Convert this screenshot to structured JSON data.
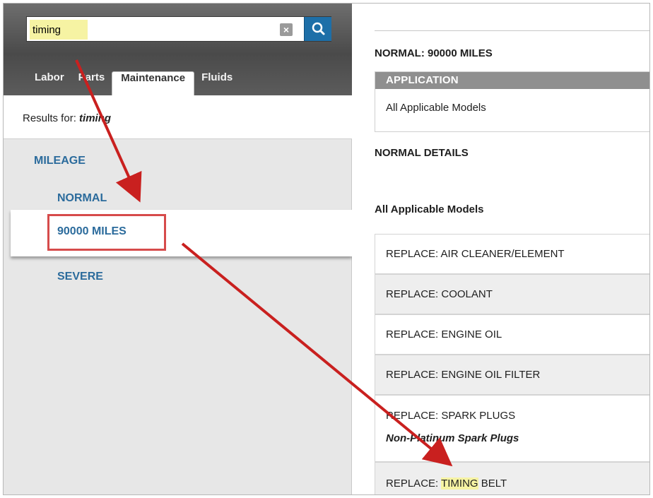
{
  "search": {
    "value": "timing"
  },
  "tabs": [
    {
      "label": "Labor"
    },
    {
      "label": "Parts"
    },
    {
      "label": "Maintenance"
    },
    {
      "label": "Fluids"
    }
  ],
  "results": {
    "prefix": "Results for: ",
    "term": "timing"
  },
  "tree": {
    "mileage": "MILEAGE",
    "normal": "NORMAL",
    "miles": "90000 MILES",
    "severe": "SEVERE"
  },
  "detail": {
    "heading": "NORMAL: 90000 MILES",
    "application_header": "APPLICATION",
    "application_value": "All Applicable Models",
    "details_heading": "NORMAL DETAILS",
    "models_heading": "All Applicable Models",
    "items": [
      {
        "label": "REPLACE: AIR CLEANER/ELEMENT"
      },
      {
        "label": "REPLACE: COOLANT"
      },
      {
        "label": "REPLACE: ENGINE OIL"
      },
      {
        "label": "REPLACE: ENGINE OIL FILTER"
      },
      {
        "label": "REPLACE: SPARK PLUGS",
        "sub": "Non-Platinum Spark Plugs"
      }
    ],
    "last_item": {
      "prefix": "REPLACE: ",
      "highlight": "TIMING",
      "suffix": " BELT"
    }
  },
  "colors": {
    "link_blue": "#2b6b9c",
    "search_button": "#1d6fa8",
    "highlight": "#f6f3a3",
    "annotation_red": "#c9201f",
    "selection_box": "#d64b4b"
  }
}
